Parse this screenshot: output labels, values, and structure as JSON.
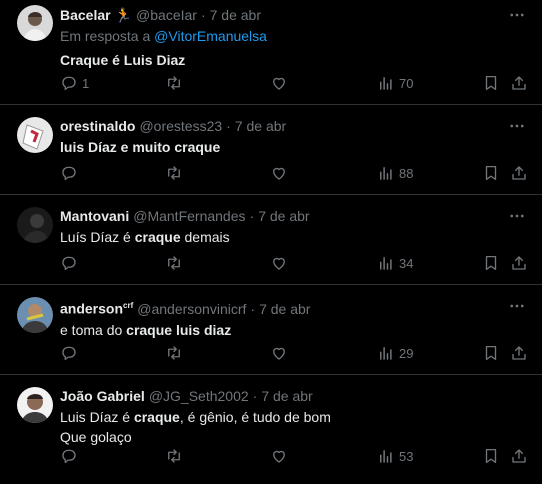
{
  "tweets": [
    {
      "name": "Bacelar",
      "badge": "🏃",
      "handle": "@baceIar",
      "dot": "·",
      "date": "7 de abr",
      "reply_prefix": "Em resposta a ",
      "reply_to": "@VitorEmanuelsa",
      "text": "Craque é Luis Diaz",
      "replies": "1",
      "views": "70"
    },
    {
      "name": "orestinaldo",
      "handle": "@orestess23",
      "dot": "·",
      "date": "7 de abr",
      "text_pre": "luis Díaz e muito ",
      "text_bold": "craque",
      "text_post": "",
      "views": "88"
    },
    {
      "name": "Mantovani",
      "handle": "@MantFernandes",
      "dot": "·",
      "date": "7 de abr",
      "text_pre": "Luís Díaz é ",
      "text_bold": "craque",
      "text_post": " demais",
      "views": "34"
    },
    {
      "name": "anderson",
      "badge": "crf",
      "handle": "@andersonvinicrf",
      "dot": "·",
      "date": "7 de abr",
      "text_pre": "e toma do ",
      "text_bold": "craque luis diaz",
      "text_post": "",
      "views": "29"
    },
    {
      "name": "João Gabriel",
      "handle": "@JG_Seth2002",
      "dot": "·",
      "date": "7 de abr",
      "text_pre": "Luis Díaz é ",
      "text_bold": "craque",
      "text_post": ", é gênio, é tudo de bom",
      "text_line2": "Que golaço",
      "views": "53"
    }
  ],
  "colors": {
    "bg": "#000000",
    "text": "#e7e9ea",
    "muted": "#71767b",
    "link": "#1d9bf0",
    "border": "#2f3336"
  },
  "icons": [
    "more-icon",
    "reply-icon",
    "retweet-icon",
    "like-icon",
    "views-icon",
    "bookmark-icon",
    "share-icon"
  ]
}
